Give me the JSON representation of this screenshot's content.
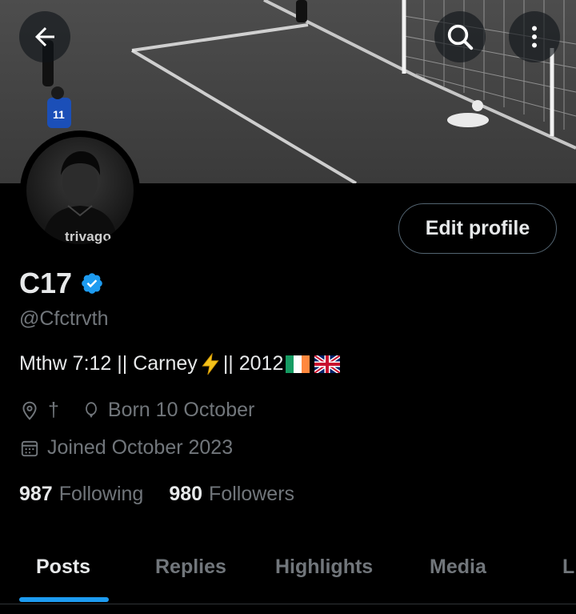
{
  "header": {
    "banner_alt": "football banner",
    "back_icon": "arrow-left-icon",
    "search_icon": "search-icon",
    "more_icon": "more-vertical-icon"
  },
  "avatar": {
    "shirt_text": "trivago"
  },
  "profile": {
    "edit_label": "Edit profile",
    "display_name": "C17",
    "handle": "@Cfctrvth",
    "bio_before": "Mthw 7:12 || Carney ",
    "bio_after": "|| 2012 ",
    "location": "†",
    "birthday": "Born 10 October",
    "joined": "Joined October 2023"
  },
  "stats": {
    "following_count": "987",
    "following_label": "Following",
    "followers_count": "980",
    "followers_label": "Followers"
  },
  "tabs": [
    {
      "label": "Posts"
    },
    {
      "label": "Replies"
    },
    {
      "label": "Highlights"
    },
    {
      "label": "Media"
    },
    {
      "label": "Li"
    }
  ],
  "colors": {
    "accent": "#1d9bf0",
    "text_primary": "#e7e9ea",
    "text_secondary": "#71767b",
    "border": "#536471"
  }
}
